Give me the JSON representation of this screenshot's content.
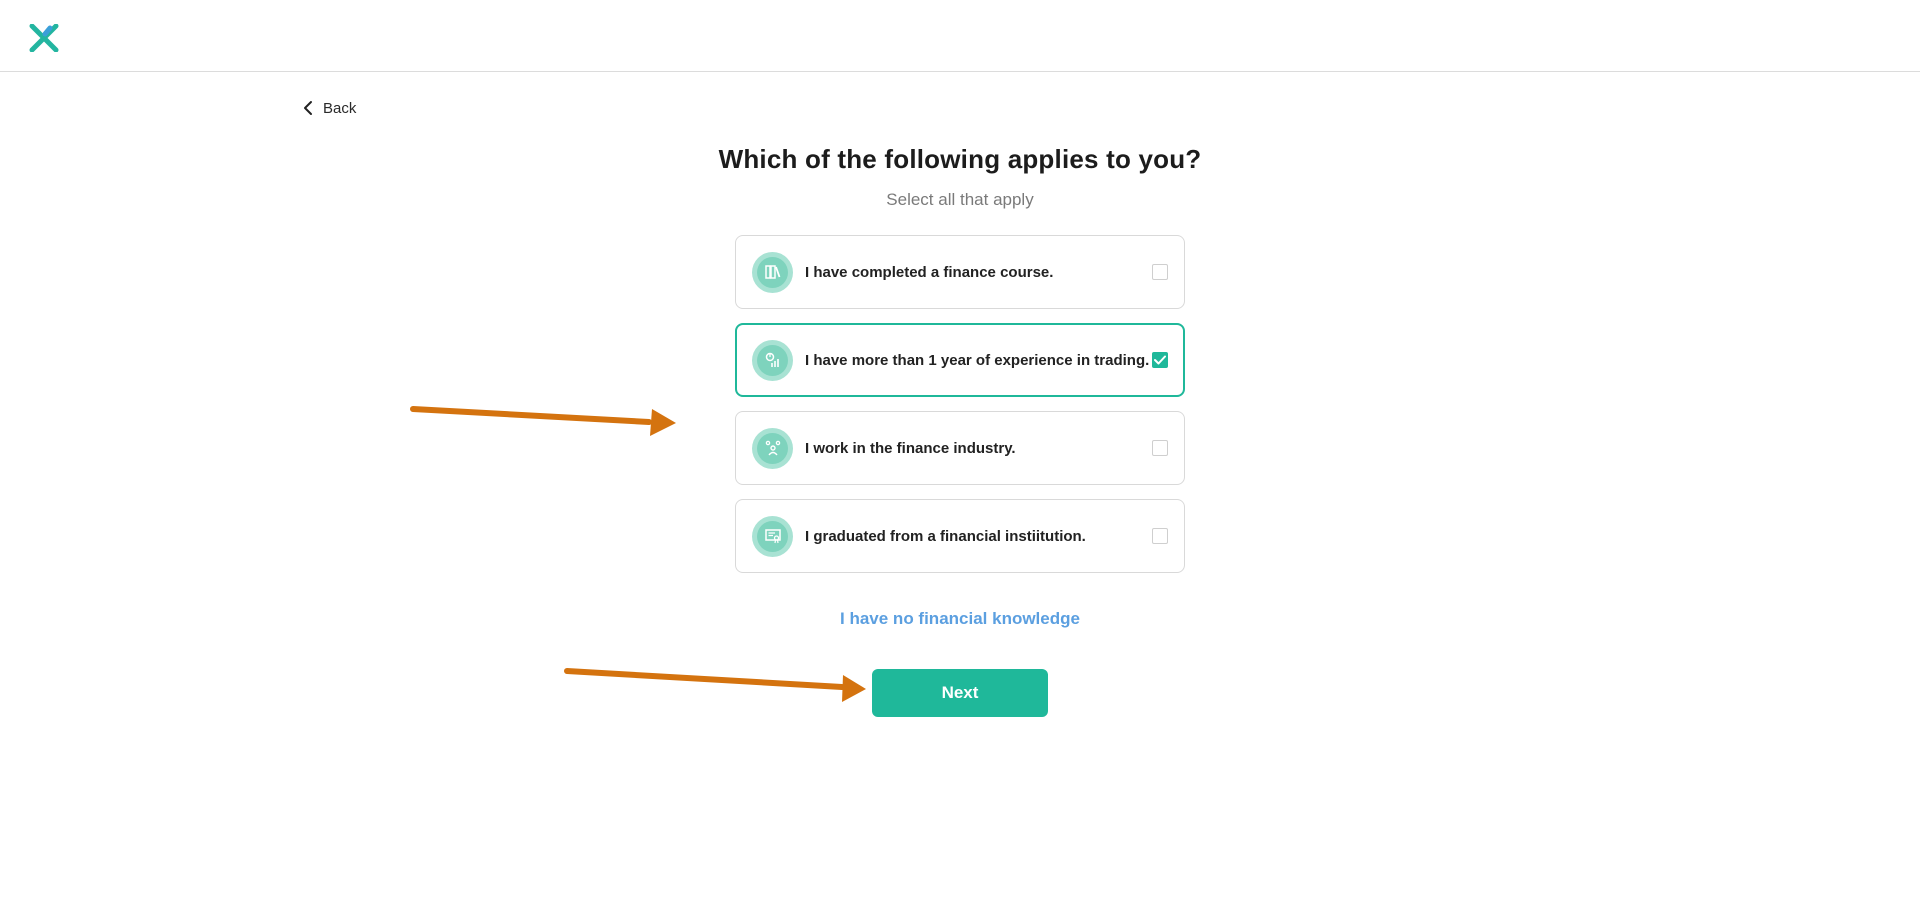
{
  "header": {
    "logo_icon": "x-brand-logo",
    "brand_colors": [
      "#23b5a0",
      "#3b9fd9"
    ]
  },
  "nav": {
    "back_label": "Back",
    "back_icon": "chevron-left-icon"
  },
  "question": {
    "title": "Which of the following applies to you?",
    "subtitle": "Select all that apply"
  },
  "options": [
    {
      "label": "I have completed a finance course.",
      "icon": "books-icon",
      "checked": false
    },
    {
      "label": "I have more than 1 year of experience in trading.",
      "icon": "chart-icon",
      "checked": true
    },
    {
      "label": "I work in the finance industry.",
      "icon": "people-icon",
      "checked": false
    },
    {
      "label": "I graduated from a financial instiitution.",
      "icon": "certificate-icon",
      "checked": false
    }
  ],
  "no_knowledge_label": "I have no financial knowledge",
  "next_label": "Next",
  "colors": {
    "accent": "#1fb89a",
    "link": "#5b9fe0",
    "annotation_arrow": "#d4730f"
  }
}
